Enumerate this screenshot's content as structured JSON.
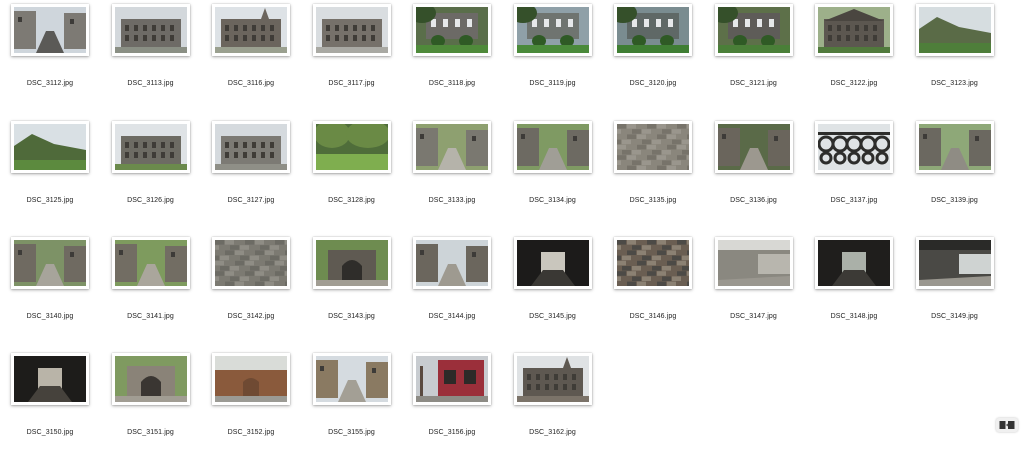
{
  "window": {
    "view": "icon-view"
  },
  "files": [
    {
      "name": "DSC_3112.jpg",
      "scene": "street",
      "colors": [
        "#cfd6dc",
        "#7d7a74",
        "#5b5a57"
      ]
    },
    {
      "name": "DSC_3113.jpg",
      "scene": "building",
      "colors": [
        "#d3d8dc",
        "#6e6b66",
        "#8a8f84"
      ]
    },
    {
      "name": "DSC_3116.jpg",
      "scene": "church",
      "colors": [
        "#dde2e6",
        "#6b655d",
        "#9aa08f"
      ]
    },
    {
      "name": "DSC_3117.jpg",
      "scene": "building",
      "colors": [
        "#d9dde0",
        "#76716a",
        "#a9a9a3"
      ]
    },
    {
      "name": "DSC_3118.jpg",
      "scene": "garden",
      "colors": [
        "#5a6e4a",
        "#6c6a66",
        "#4f8a3a"
      ]
    },
    {
      "name": "DSC_3119.jpg",
      "scene": "garden",
      "colors": [
        "#8fa0a8",
        "#6f7470",
        "#4a8a3a"
      ]
    },
    {
      "name": "DSC_3120.jpg",
      "scene": "garden",
      "colors": [
        "#7a8c90",
        "#5f6866",
        "#3f7e33"
      ]
    },
    {
      "name": "DSC_3121.jpg",
      "scene": "garden",
      "colors": [
        "#5d7049",
        "#5e5c58",
        "#4a7f38"
      ]
    },
    {
      "name": "DSC_3122.jpg",
      "scene": "cottage",
      "colors": [
        "#9db08a",
        "#5c5750",
        "#517a3c"
      ]
    },
    {
      "name": "DSC_3123.jpg",
      "scene": "hill",
      "colors": [
        "#d6dde0",
        "#5a6b47",
        "#4e7e3a"
      ]
    },
    {
      "name": "DSC_3125.jpg",
      "scene": "hill",
      "colors": [
        "#d9e0e4",
        "#4f6a3a",
        "#5c8a3e"
      ]
    },
    {
      "name": "DSC_3126.jpg",
      "scene": "building",
      "colors": [
        "#dfe3e6",
        "#6d6b63",
        "#6b8a4c"
      ]
    },
    {
      "name": "DSC_3127.jpg",
      "scene": "building",
      "colors": [
        "#d5dade",
        "#7c7a74",
        "#8f8f87"
      ]
    },
    {
      "name": "DSC_3128.jpg",
      "scene": "park",
      "colors": [
        "#4f6d3a",
        "#6a8a45",
        "#7fae4f"
      ]
    },
    {
      "name": "DSC_3133.jpg",
      "scene": "lane",
      "colors": [
        "#8ea070",
        "#7a7870",
        "#b5b3aa"
      ]
    },
    {
      "name": "DSC_3134.jpg",
      "scene": "lane",
      "colors": [
        "#7f9a63",
        "#6d6a62",
        "#a09e96"
      ]
    },
    {
      "name": "DSC_3135.jpg",
      "scene": "wall",
      "colors": [
        "#8a867c",
        "#77736a",
        "#9a968d"
      ]
    },
    {
      "name": "DSC_3136.jpg",
      "scene": "lane",
      "colors": [
        "#5a6a48",
        "#6a655c",
        "#9c988f"
      ]
    },
    {
      "name": "DSC_3137.jpg",
      "scene": "ironwork",
      "colors": [
        "#dfe3e5",
        "#2d2d2b",
        "#555350"
      ]
    },
    {
      "name": "DSC_3139.jpg",
      "scene": "lane",
      "colors": [
        "#8ea878",
        "#6b6860",
        "#8f8c84"
      ]
    },
    {
      "name": "DSC_3140.jpg",
      "scene": "steps",
      "colors": [
        "#7d9266",
        "#6f6a61",
        "#a7a49b"
      ]
    },
    {
      "name": "DSC_3141.jpg",
      "scene": "lane",
      "colors": [
        "#7e9b5e",
        "#726d63",
        "#aaa69c"
      ]
    },
    {
      "name": "DSC_3142.jpg",
      "scene": "cobbles",
      "colors": [
        "#7c7a72",
        "#6c6b64",
        "#8f8d85"
      ]
    },
    {
      "name": "DSC_3143.jpg",
      "scene": "arch",
      "colors": [
        "#6e8c50",
        "#5f5a52",
        "#2f2d2a"
      ]
    },
    {
      "name": "DSC_3144.jpg",
      "scene": "lane",
      "colors": [
        "#cdd4d8",
        "#6b665d",
        "#9e9a90"
      ]
    },
    {
      "name": "DSC_3145.jpg",
      "scene": "tunnel",
      "colors": [
        "#1c1b1a",
        "#3a3834",
        "#c9c6bd"
      ]
    },
    {
      "name": "DSC_3146.jpg",
      "scene": "wall",
      "colors": [
        "#6a5e52",
        "#4c4a46",
        "#8b8173"
      ]
    },
    {
      "name": "DSC_3147.jpg",
      "scene": "underpass",
      "colors": [
        "#d8d8d4",
        "#8a8880",
        "#b8b6ae"
      ]
    },
    {
      "name": "DSC_3148.jpg",
      "scene": "tunnel",
      "colors": [
        "#1f1e1c",
        "#3c3a36",
        "#aab0a8"
      ]
    },
    {
      "name": "DSC_3149.jpg",
      "scene": "underpass",
      "colors": [
        "#2a2a28",
        "#4a4945",
        "#cfd3d2"
      ]
    },
    {
      "name": "DSC_3150.jpg",
      "scene": "tunnel",
      "colors": [
        "#1d1c1a",
        "#46423c",
        "#b9b4a8"
      ]
    },
    {
      "name": "DSC_3151.jpg",
      "scene": "arch",
      "colors": [
        "#7f9a60",
        "#8a8378",
        "#3a3632"
      ]
    },
    {
      "name": "DSC_3152.jpg",
      "scene": "brickwall",
      "colors": [
        "#d9dcd8",
        "#8a5a3c",
        "#6f4a33"
      ]
    },
    {
      "name": "DSC_3155.jpg",
      "scene": "street",
      "colors": [
        "#d5dbe0",
        "#8a7a62",
        "#a39f95"
      ]
    },
    {
      "name": "DSC_3156.jpg",
      "scene": "pub",
      "colors": [
        "#c8ccd0",
        "#9b2f3a",
        "#5a4a40"
      ]
    },
    {
      "name": "DSC_3162.jpg",
      "scene": "tower",
      "colors": [
        "#dfe2e4",
        "#5e5851",
        "#7b7369"
      ]
    }
  ]
}
